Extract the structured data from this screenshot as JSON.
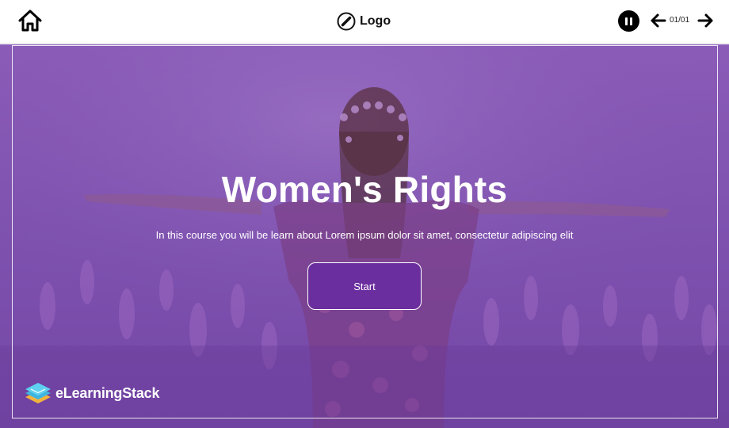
{
  "topbar": {
    "home_icon": "home-icon",
    "logo_icon": "slash-circle-icon",
    "logo_text": "Logo",
    "pause_icon": "pause-icon",
    "prev_icon": "arrow-left-icon",
    "next_icon": "arrow-right-icon",
    "page_counter": "01/01"
  },
  "hero": {
    "title": "Women's Rights",
    "subtitle": "In this course you will be learn about Lorem ipsum dolor sit amet, consectetur adipiscing elit",
    "start_label": "Start",
    "overlay_color": "#7f52b0",
    "button_color": "#6b2e9e"
  },
  "brand": {
    "icon": "stacked-books-icon",
    "text": "eLearningStack"
  }
}
